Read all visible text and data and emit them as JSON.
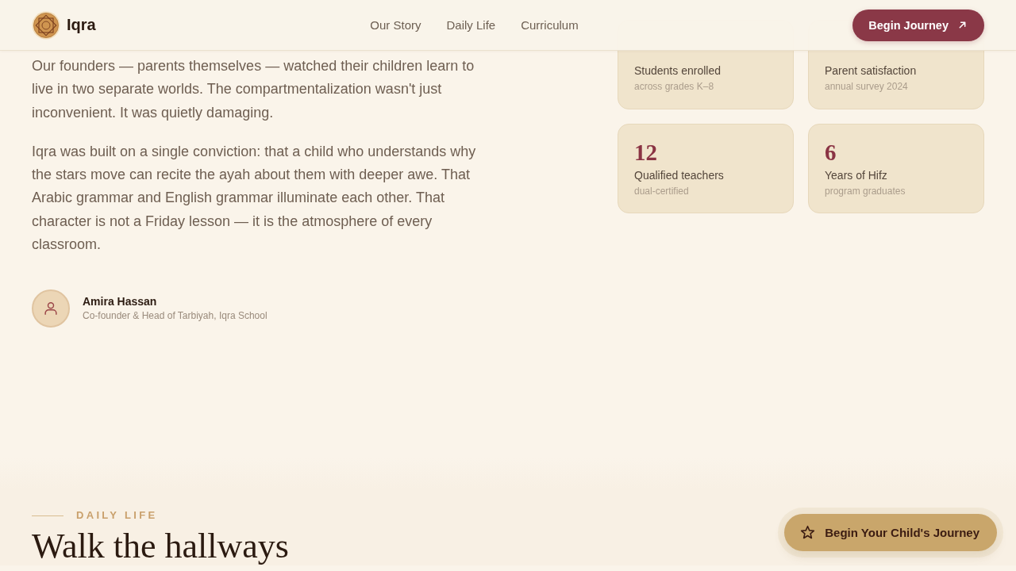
{
  "header": {
    "brand": "Iqra",
    "nav": [
      "Our Story",
      "Daily Life",
      "Curriculum"
    ],
    "cta": "Begin Journey"
  },
  "story": {
    "paragraphs": [
      "Our founders — parents themselves — watched their children learn to live in two separate worlds. The compartmentalization wasn't just inconvenient. It was quietly damaging.",
      "Iqra was built on a single conviction: that a child who understands why the stars move can recite the ayah about them with deeper awe. That Arabic grammar and English grammar illuminate each other. That character is not a Friday lesson — it is the atmosphere of every classroom."
    ],
    "author": {
      "name": "Amira Hassan",
      "role": "Co-founder & Head of Tarbiyah, Iqra School"
    }
  },
  "stats": [
    {
      "label": "Students enrolled",
      "note": "across grades K–8"
    },
    {
      "label": "Parent satisfaction",
      "note": "annual survey 2024"
    },
    {
      "value": "12",
      "label": "Qualified teachers",
      "note": "dual-certified"
    },
    {
      "value": "6",
      "label": "Years of Hifz",
      "note": "program graduates"
    }
  ],
  "daily_life": {
    "eyebrow": "DAILY LIFE",
    "heading": "Walk the hallways"
  },
  "floating_cta": "Begin Your Child's Journey"
}
